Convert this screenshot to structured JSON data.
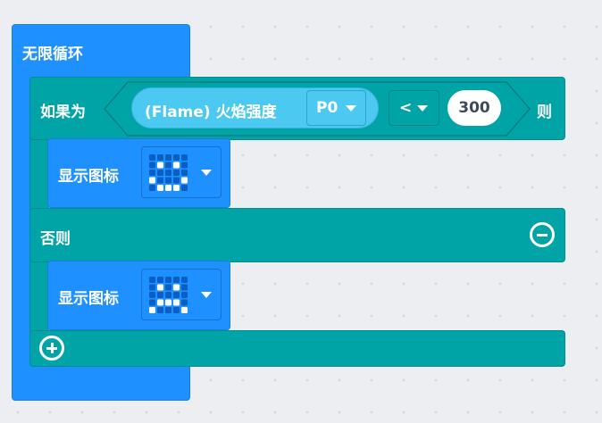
{
  "forever": {
    "label": "无限循环",
    "color": "#1e90ff"
  },
  "if_block": {
    "if_label": "如果为",
    "then_label": "则",
    "else_label": "否则",
    "color": "#00a4a6",
    "condition": {
      "sensor_label": "(Flame) 火焰强度",
      "pin_value": "P0",
      "operator": "<",
      "number": "300",
      "sensor_color": "#4cc9f0"
    },
    "remove_else_icon": "minus-circle-icon",
    "add_branch_icon": "plus-circle-icon"
  },
  "show_icons": [
    {
      "label": "显示图标",
      "icon": "happy-face-led-icon"
    },
    {
      "label": "显示图标",
      "icon": "sad-face-led-icon"
    }
  ]
}
